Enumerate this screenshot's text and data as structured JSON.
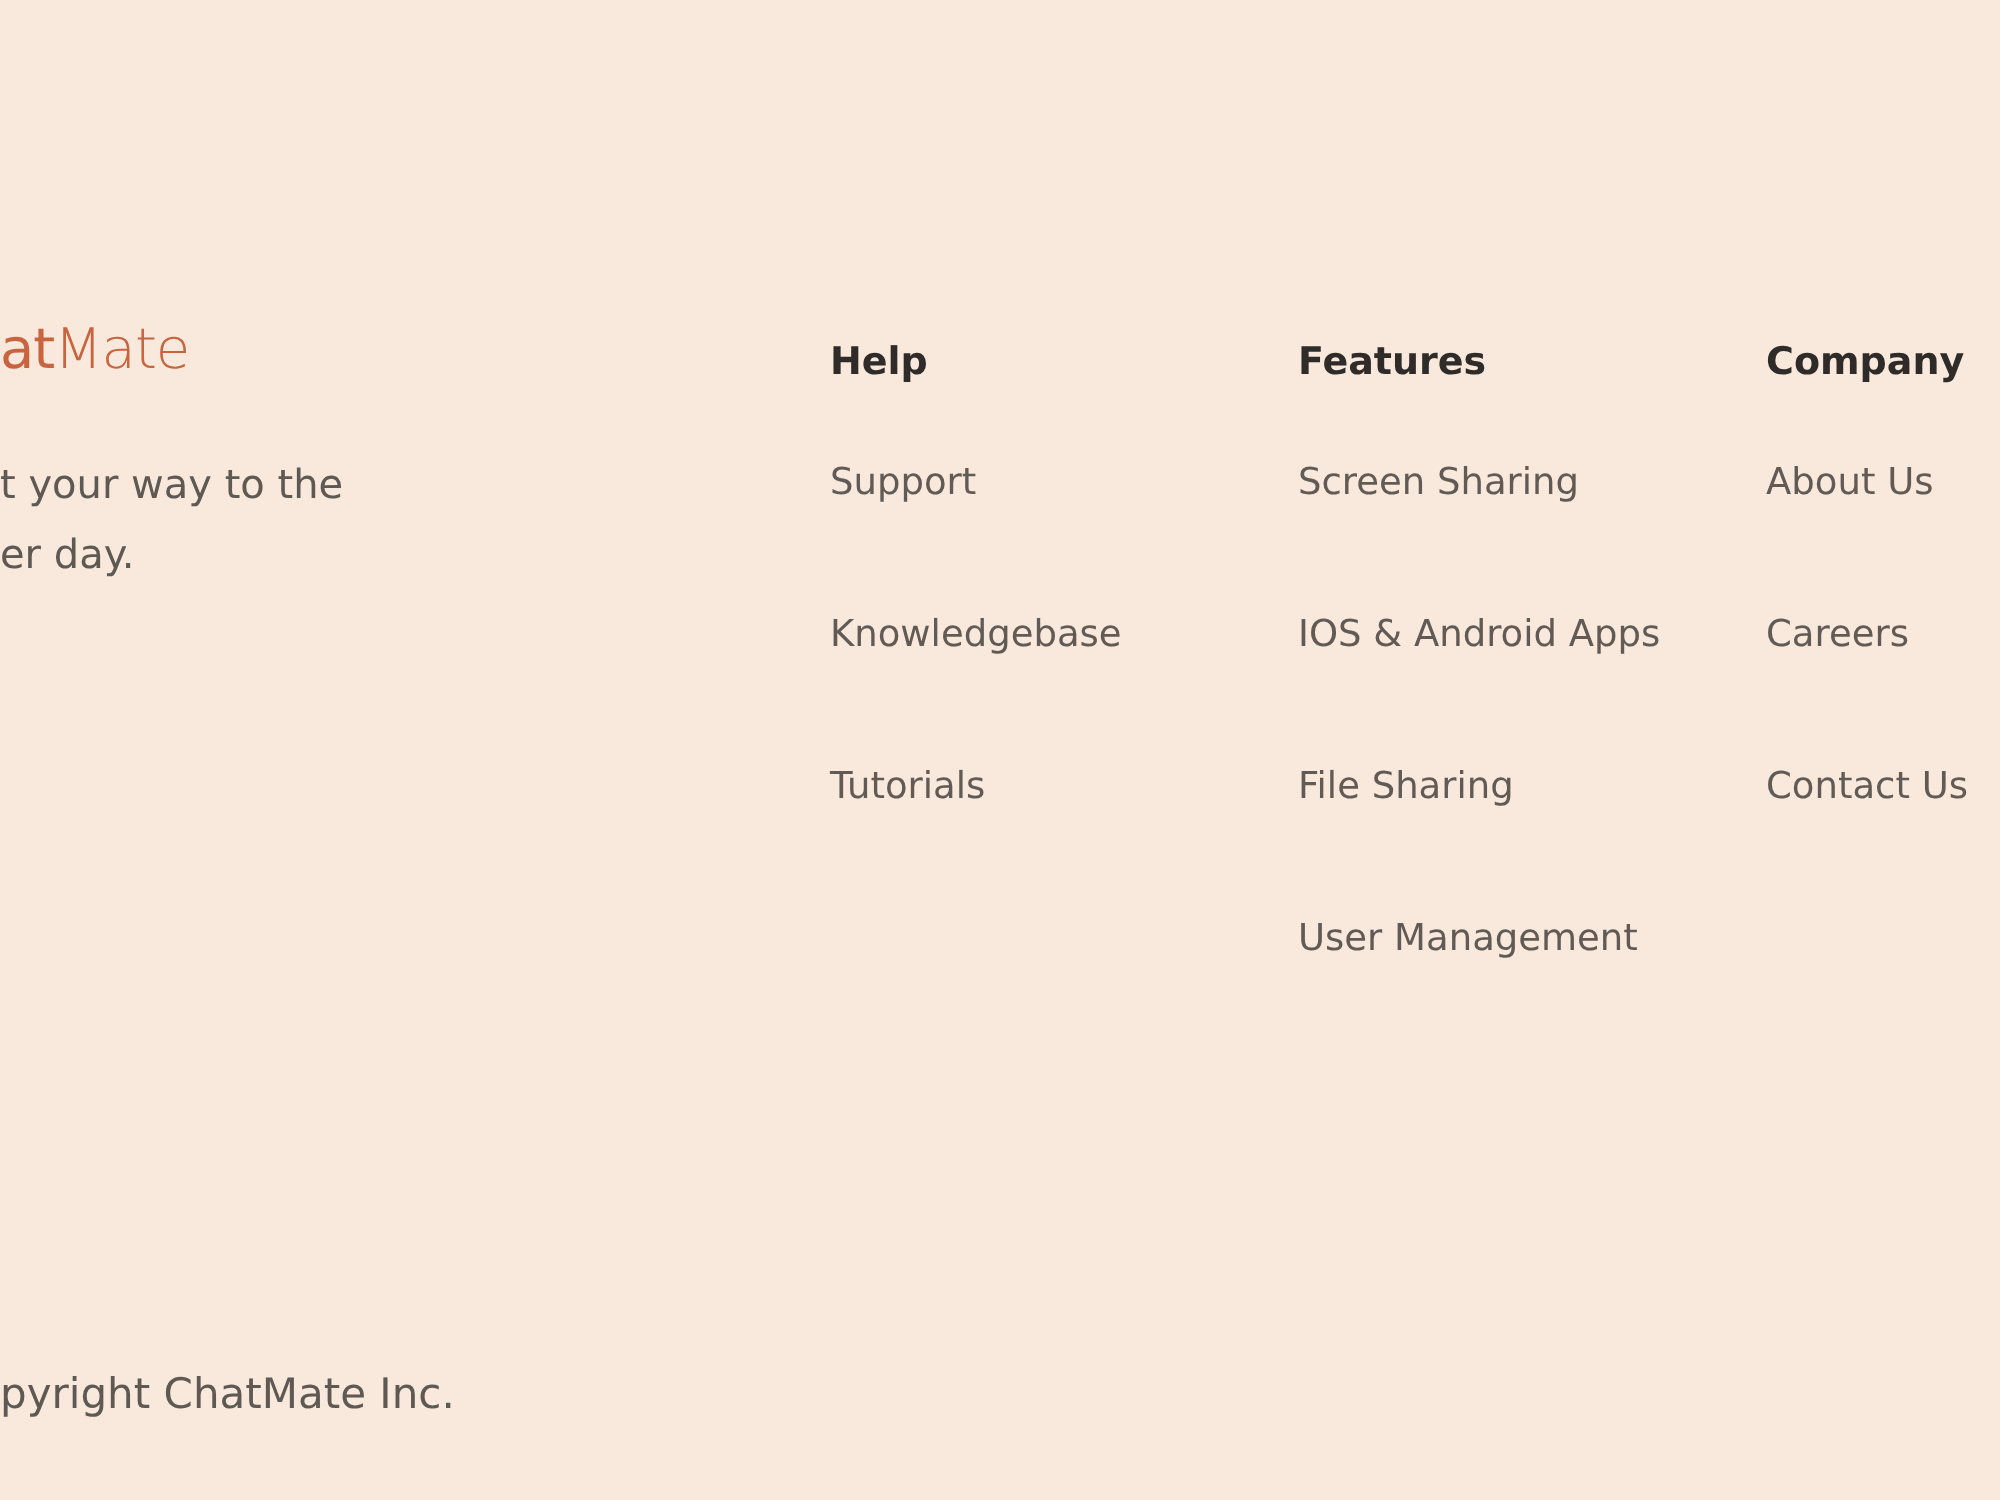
{
  "brand": {
    "wordmark": "**at**Mate"
  },
  "tagline": {
    "lines": [
      "t your way to the",
      "er day."
    ]
  },
  "columns": [
    {
      "heading": "Help",
      "links": [
        "Support",
        "Knowledgebase",
        "Tutorials"
      ]
    },
    {
      "heading": "Features",
      "links": [
        "Screen Sharing",
        "IOS & Android Apps",
        "File Sharing",
        "User Management"
      ]
    },
    {
      "heading": "Company",
      "links": [
        "About Us",
        "Careers",
        "Contact Us"
      ]
    }
  ],
  "copyright": "pyright ChatMate Inc."
}
